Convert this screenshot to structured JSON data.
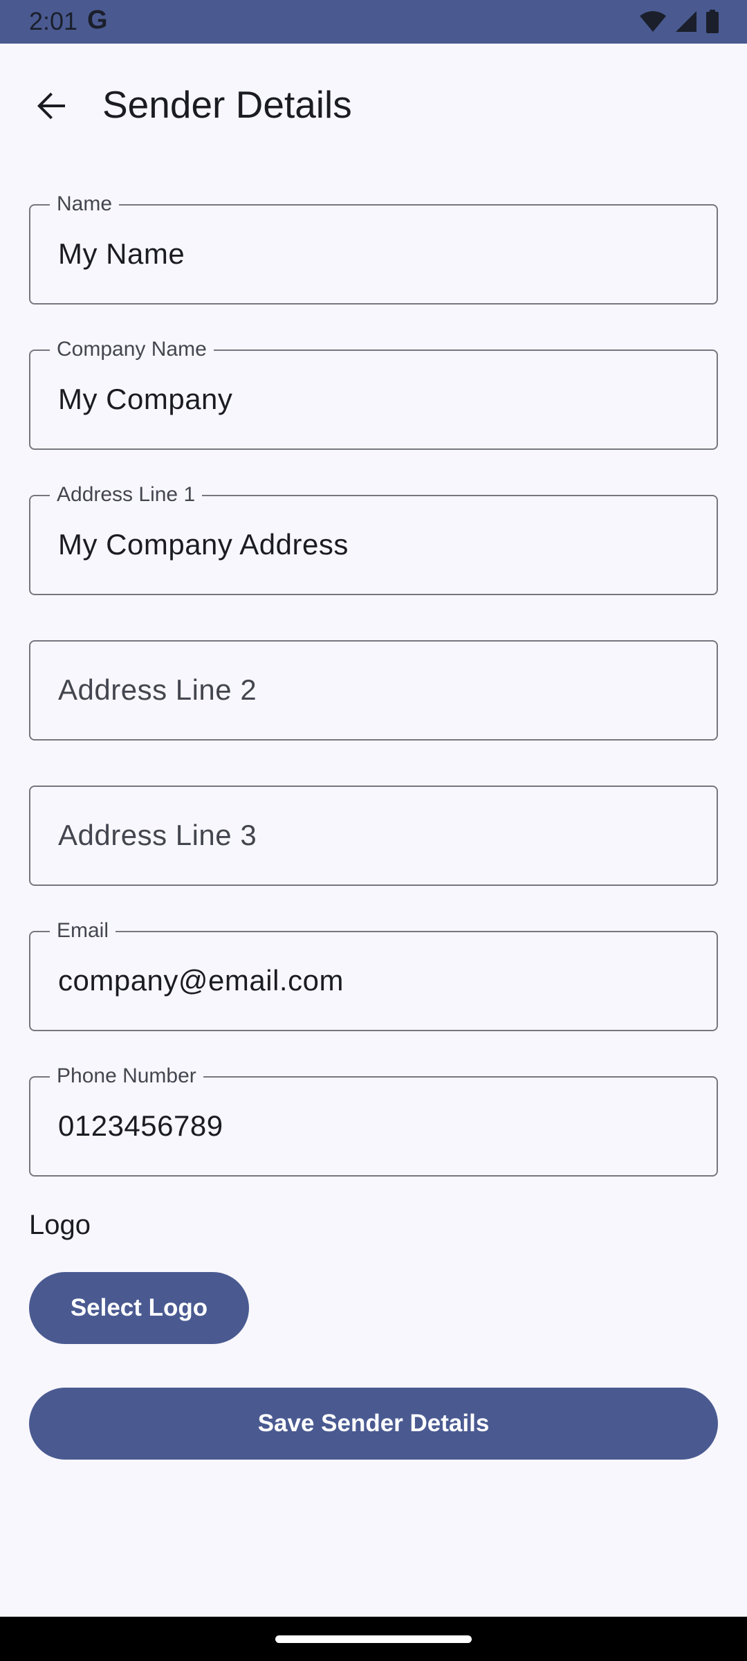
{
  "status_bar": {
    "time": "2:01",
    "google_icon": "G",
    "icons": [
      "wifi-icon",
      "signal-icon",
      "battery-icon"
    ]
  },
  "app_bar": {
    "title": "Sender Details",
    "back_icon": "arrow-back-icon"
  },
  "fields": {
    "name": {
      "label": "Name",
      "value": "My Name"
    },
    "company_name": {
      "label": "Company Name",
      "value": "My Company"
    },
    "address_line_1": {
      "label": "Address Line 1",
      "value": "My Company Address"
    },
    "address_line_2": {
      "placeholder": "Address Line 2"
    },
    "address_line_3": {
      "placeholder": "Address Line 3"
    },
    "email": {
      "label": "Email",
      "value": "company@email.com"
    },
    "phone": {
      "label": "Phone Number",
      "value": "0123456789"
    }
  },
  "logo": {
    "heading": "Logo",
    "select_button": "Select Logo"
  },
  "actions": {
    "save_button": "Save Sender Details"
  },
  "colors": {
    "primary": "#4a5a91",
    "background": "#f8f7fd",
    "outline": "#767680"
  }
}
